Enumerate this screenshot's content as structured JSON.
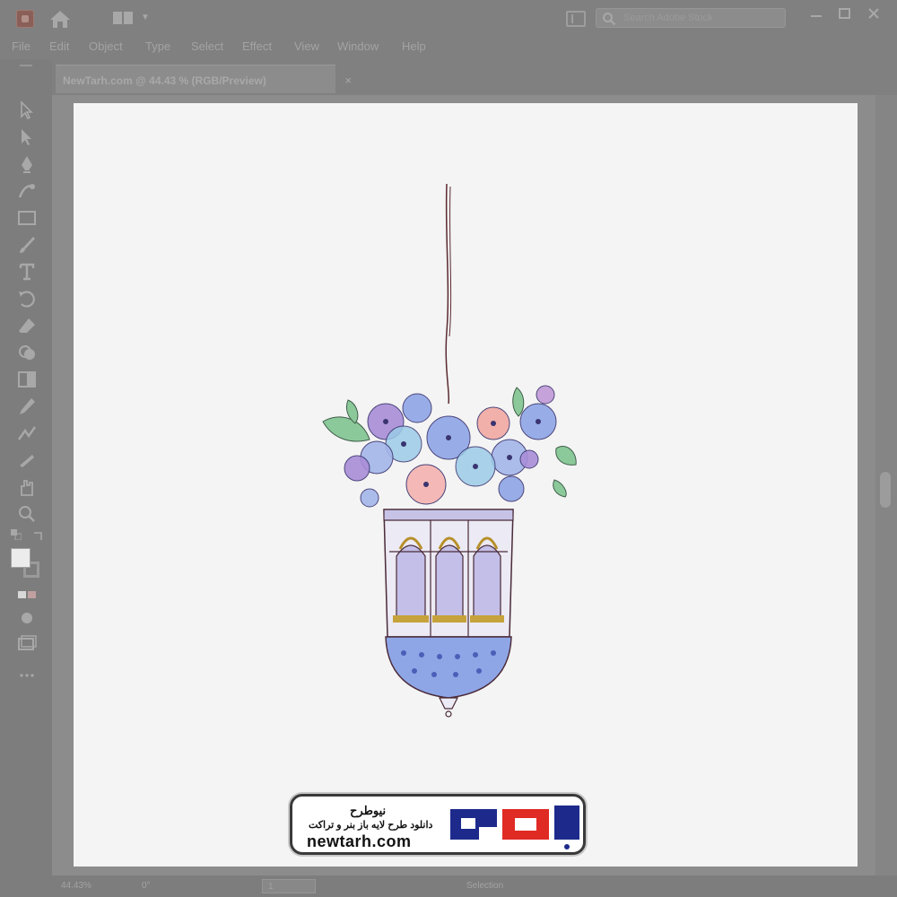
{
  "titlebar": {
    "search_placeholder": "Search Adobe Stock"
  },
  "menu": [
    "File",
    "Edit",
    "Object",
    "Type",
    "Select",
    "Effect",
    "View",
    "Window",
    "Help"
  ],
  "document": {
    "tab_title": "NewTarh.com @ 44.43 % (RGB/Preview)",
    "close_glyph": "×"
  },
  "status": {
    "zoom": "44.43%",
    "rotation": "0°",
    "artboard_number": "1",
    "tool": "Selection"
  },
  "watermark": {
    "title": "نیوطرح",
    "subtitle": "دانلود طرح لایه باز بنر و تراکت",
    "url": "newtarh.com",
    "logo_text": "نیوطرح"
  },
  "colors": {
    "chrome": "#808080",
    "artboard": "#f4f4f4",
    "logo_red": "#e02a24",
    "logo_blue": "#1d2a8c"
  }
}
